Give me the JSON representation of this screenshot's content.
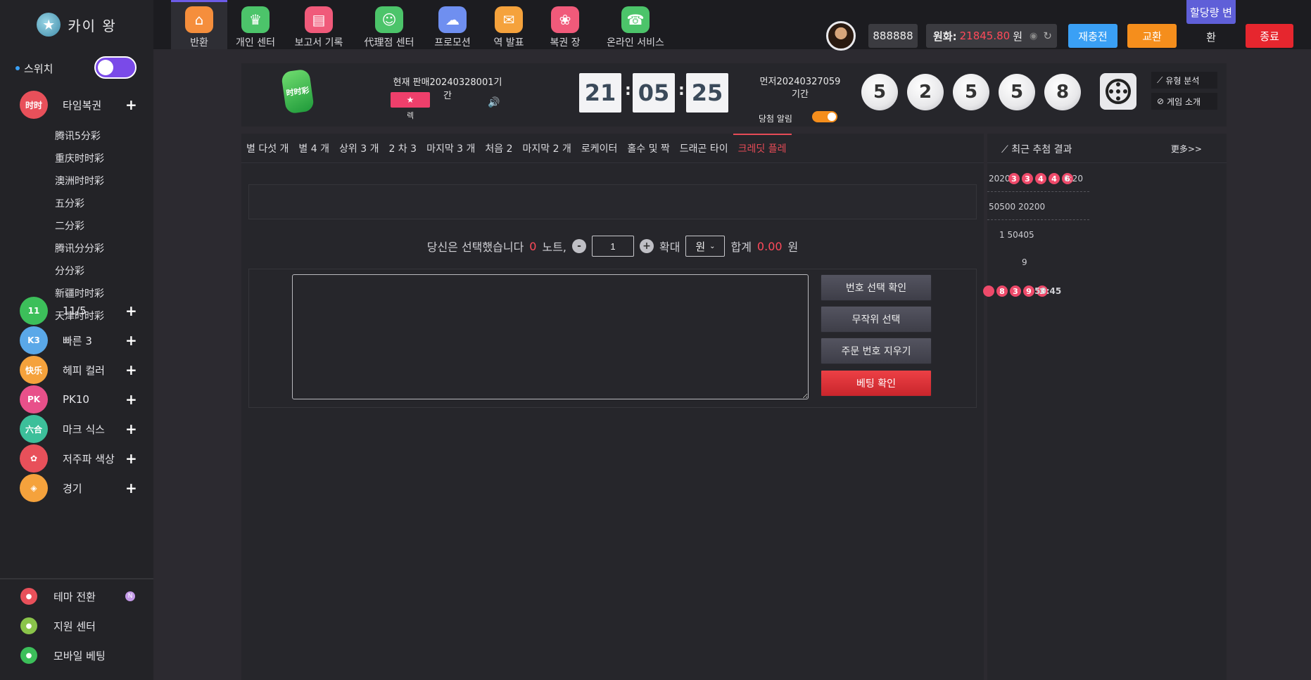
{
  "header": {
    "logo_text": "카이 왕",
    "nav": [
      {
        "label": "반환",
        "icon": "home-icon",
        "color": "#f58e3c",
        "glyph": "⌂"
      },
      {
        "label": "개인 센터",
        "icon": "crown-icon",
        "color": "#4cc46a",
        "glyph": "♛"
      },
      {
        "label": "보고서 기록",
        "icon": "report-icon",
        "color": "#f05a7a",
        "glyph": "▤"
      },
      {
        "label": "代理점 센터",
        "icon": "agent-icon",
        "color": "#4cc46a",
        "glyph": "☺"
      },
      {
        "label": "프로모션",
        "icon": "promotion-icon",
        "color": "#6f8ff0",
        "glyph": "☁"
      },
      {
        "label": "역 발표",
        "icon": "mail-icon",
        "color": "#f5a23c",
        "glyph": "✉"
      },
      {
        "label": "복권 장",
        "icon": "lottery-icon",
        "color": "#f05a7a",
        "glyph": "❀"
      },
      {
        "label": "온라인 서비스",
        "icon": "service-icon",
        "color": "#4cc46a",
        "glyph": "☎"
      }
    ],
    "user_id": "888888",
    "balance_label": "원화:",
    "balance_value": "21845.80",
    "balance_unit": "원",
    "recharge": "재충전",
    "exchange": "교환",
    "quota": "할당량 변",
    "quota_sub": "환",
    "exit": "종료"
  },
  "sidebar": {
    "switch_label": "스위치",
    "categories": [
      {
        "label": "타임복권",
        "icon": "time-lottery-icon",
        "color": "#e8505a",
        "glyph": "时时"
      },
      {
        "label": "11/5",
        "icon": "eleven-five-icon",
        "color": "#3cbf5a",
        "glyph": "11"
      },
      {
        "label": "빠른 3",
        "icon": "fast-three-icon",
        "color": "#5aa8e8",
        "glyph": "K3"
      },
      {
        "label": "헤피 컬러",
        "icon": "happy-color-icon",
        "color": "#f5a23c",
        "glyph": "快乐"
      },
      {
        "label": "PK10",
        "icon": "pk10-icon",
        "color": "#e8508a",
        "glyph": "PK"
      },
      {
        "label": "마크 식스",
        "icon": "mark-six-icon",
        "color": "#3cbf9a",
        "glyph": "六合"
      },
      {
        "label": "저주파 색상",
        "icon": "low-freq-icon",
        "color": "#e8505a",
        "glyph": "✿"
      },
      {
        "label": "경기",
        "icon": "game-icon",
        "color": "#f5a23c",
        "glyph": "◈"
      }
    ],
    "sub_items": [
      "腾讯5分彩",
      "重庆时时彩",
      "澳洲时时彩",
      "五分彩",
      "二分彩",
      "腾讯分分彩",
      "分分彩",
      "新疆时时彩",
      "天津时时彩"
    ],
    "utilities": [
      {
        "label": "테마 전환",
        "icon": "theme-icon",
        "color": "#e8505a",
        "badge": "N"
      },
      {
        "label": "지원 센터",
        "icon": "help-icon",
        "color": "#8ac44a",
        "badge": ""
      },
      {
        "label": "모바일 베팅",
        "icon": "mobile-icon",
        "color": "#3cbf5a",
        "badge": ""
      }
    ]
  },
  "info": {
    "game_logo_text": "时时彩",
    "current_issue": "현재 판매20240328001기간",
    "favorite_label": "렉",
    "timer": {
      "h": "21",
      "m": "05",
      "s": "25"
    },
    "previous_issue": "먼저20240327059기간",
    "notify_label": "당첨 알림",
    "draw_numbers": [
      "5",
      "2",
      "5",
      "5",
      "8"
    ],
    "trend_link": "유형 분석",
    "intro_link": "게임 소개"
  },
  "betting": {
    "tabs": [
      "별 다섯 개",
      "별 4 개",
      "상위 3 개",
      "2 차 3",
      "마지막 3 개",
      "처음 2",
      "마지막 2 개",
      "로케이터",
      "홀수 및 짝",
      "드래곤 타이",
      "크레딧 플레"
    ],
    "active_tab": 10,
    "selected_prefix": "당신은 선택했습니다",
    "selected_count": "0",
    "notes_label": "노트,",
    "minus": "-",
    "multiple": "1",
    "plus": "+",
    "magnify_label": "확대",
    "unit": "원",
    "total_label": "합계",
    "total_value": "0.00",
    "total_unit": "원",
    "buttons": {
      "confirm_number": "번호 선택 확인",
      "random": "무작위 선택",
      "clear": "주문 번호 지우기",
      "bet": "베팅 확인"
    }
  },
  "results": {
    "title": "최근 추첨 결과",
    "more": "更多>>",
    "row1_prefix": "2020",
    "row1_balls": [
      "3",
      "3",
      "4",
      "4",
      "6"
    ],
    "row1_suffix": "0:20",
    "row2": "50500  20200",
    "row3": "1     50405",
    "row4": "9",
    "row5_balls": [
      "",
      "8",
      "3",
      "9",
      "3"
    ],
    "row5_suffix": "50:45"
  }
}
